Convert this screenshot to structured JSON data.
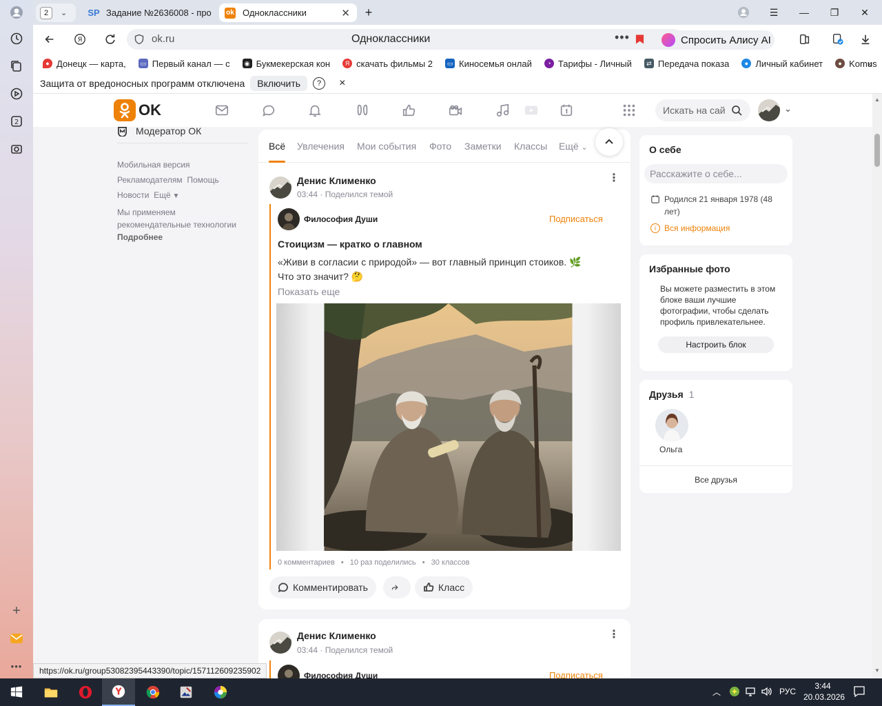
{
  "tabs": {
    "count_badge": "2",
    "tab1_title": "Задание №2636008 - про",
    "tab1_fav": "SP",
    "tab2_title": "Одноклассники"
  },
  "nav": {
    "url": "ok.ru",
    "page_title": "Одноклассники",
    "alice_label": "Спросить Алису AI"
  },
  "bookmarks": [
    {
      "label": "Донецк — карта, ",
      "color": "#e53935",
      "icon": "map-pin-icon"
    },
    {
      "label": "Первый канал — с",
      "color": "#5c6bc0",
      "icon": "tv-icon"
    },
    {
      "label": "Букмекерская кон",
      "color": "#222222",
      "icon": "bookmaker-icon"
    },
    {
      "label": "скачать фильмы 2",
      "color": "#e53935",
      "icon": "yandex-icon"
    },
    {
      "label": "Киносемья онлай",
      "color": "#1565c0",
      "icon": "monitor-icon"
    },
    {
      "label": "Тарифы - Личный",
      "color": "#7b1fa2",
      "icon": "tariff-icon"
    },
    {
      "label": "Передача показа",
      "color": "#455a64",
      "icon": "transfer-icon"
    },
    {
      "label": "Личный кабинет",
      "color": "#1e88e5",
      "icon": "drop-icon"
    },
    {
      "label": "Komus",
      "color": "#6d4c41",
      "icon": "komus-icon"
    }
  ],
  "protection": {
    "text": "Защита от вредоносных программ отключена",
    "enable_label": "Включить",
    "help": "?",
    "close": "×"
  },
  "ok_header": {
    "logo_text": "OK",
    "search_placeholder": "Искать на сай"
  },
  "left_column": {
    "moderator": "Модератор ОК",
    "links": [
      "Мобильная версия",
      "Рекламодателям",
      "Помощь",
      "Новости",
      "Ещё"
    ],
    "recommend_text_1": "Мы применяем",
    "recommend_text_2": "рекомендательные технологии",
    "more": "Подробнее"
  },
  "feed_tabs": [
    "Всё",
    "Увлечения",
    "Мои события",
    "Фото",
    "Заметки",
    "Классы",
    "Ещё"
  ],
  "posts": [
    {
      "author": "Денис Клименко",
      "time": "03:44",
      "action": "Поделился темой",
      "group": "Философия Души",
      "subscribe": "Подписаться",
      "title": "Стоицизм — кратко о главном",
      "line1": "«Живи в согласии с природой» — вот главный принцип стоиков. 🌿",
      "line2": "Что это значит? 🤔",
      "show_more": "Показать еще",
      "comments": "0 комментариев",
      "shares": "10 раз поделились",
      "likes": "30 классов",
      "comment_btn": "Комментировать",
      "like_btn": "Класс"
    },
    {
      "author": "Денис Клименко",
      "time": "03:44",
      "action": "Поделился темой",
      "group": "Философия Души",
      "subscribe": "Подписаться"
    }
  ],
  "about": {
    "title": "О себе",
    "input_placeholder": "Расскажите о себе...",
    "born": "Родился 21 января 1978 (48 лет)",
    "all_info": "Вся информация"
  },
  "fav_photos": {
    "title": "Избранные фото",
    "text": "Вы можете разместить в этом блоке ваши лучшие фотографии, чтобы сделать профиль привлекательнее.",
    "button": "Настроить блок"
  },
  "friends": {
    "title": "Друзья",
    "count": "1",
    "friend_name": "Ольга",
    "all_link": "Все друзья"
  },
  "status_url": "https://ok.ru/group53082395443390/topic/157112609235902",
  "taskbar": {
    "lang": "РУС",
    "time": "3:44",
    "date": "20.03.2026"
  },
  "colors": {
    "ok_orange": "#ee8208",
    "sidebar_top": "#dde3ee",
    "taskbar": "#1f2530"
  }
}
